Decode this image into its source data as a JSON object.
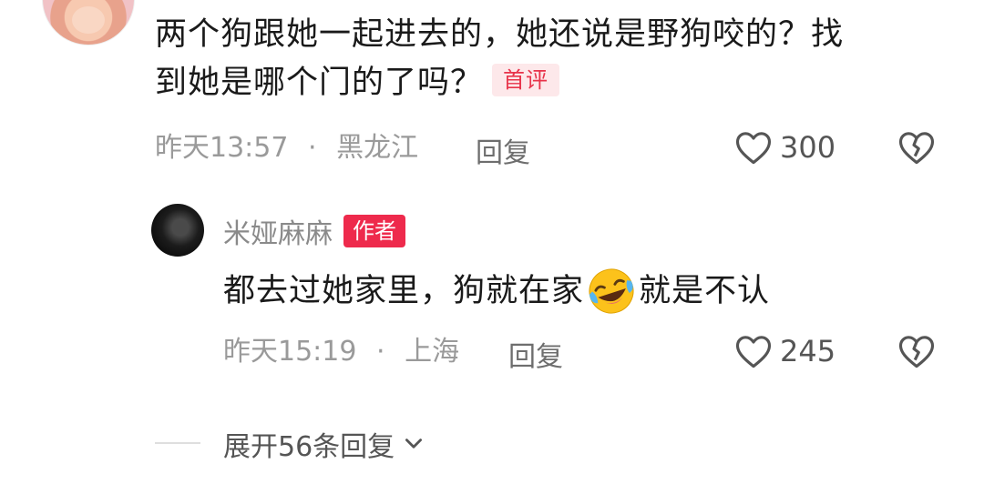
{
  "comment1": {
    "line1": "两个狗跟她一起进去的，她还说是野狗咬的？找",
    "line2": "到她是哪个门的了吗？",
    "badge": "首评",
    "time": "昨天13:57",
    "sep": "·",
    "location": "黑龙江",
    "reply": "回复",
    "likes": "300"
  },
  "reply1": {
    "username": "米娅麻麻",
    "badge": "作者",
    "text_before": "都去过她家里，狗就在家",
    "emoji": "laughing-crying-emoji",
    "text_after": "就是不认",
    "time": "昨天15:19",
    "sep": "·",
    "location": "上海",
    "reply": "回复",
    "likes": "245"
  },
  "expand": {
    "label": "展开56条回复"
  },
  "colors": {
    "accent": "#ee2a4c",
    "meta": "#9a9a9a"
  }
}
